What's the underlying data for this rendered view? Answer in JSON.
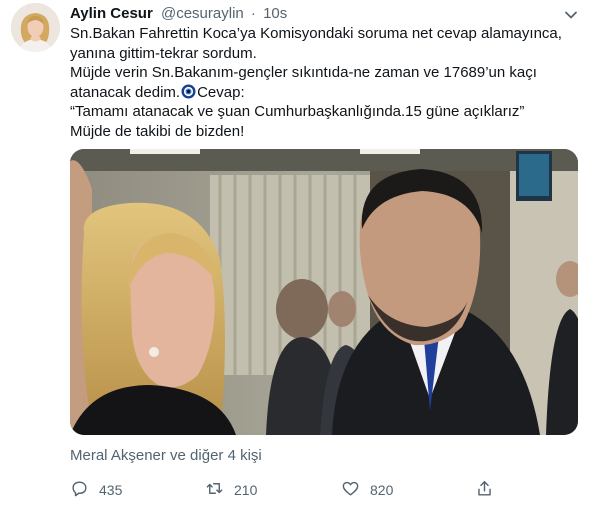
{
  "tweet": {
    "display_name": "Aylin Cesur",
    "handle": "@cesuraylin",
    "separator": "·",
    "time": "10s",
    "text_lines": [
      "Sn.Bakan Fahrettin Koca’ya Komisyondaki soruma net cevap alamayınca,",
      "yanına gittim-tekrar sordum.",
      "Müjde verin Sn.Bakanım-gençler sıkıntıda-ne zaman ve 17689’un kaçı",
      "“Tamamı atanacak ve şuan Cumhurbaşkanlığında.15 güne açıklarız”",
      "Müjde de takibi de bizden!"
    ],
    "line4_before": "atanacak dedim.",
    "line4_after": "Cevap:",
    "nazar_icon": "nazar-boncugu-icon",
    "likers": "Meral Akşener ve diğer 4 kişi",
    "actions": {
      "reply_count": "435",
      "retweet_count": "210",
      "like_count": "820"
    }
  },
  "colors": {
    "text": "#0f1419",
    "secondary": "#536471",
    "nazar_blue": "#1d3f91"
  },
  "icons": [
    "more-icon",
    "reply-icon",
    "retweet-icon",
    "like-icon",
    "share-icon"
  ]
}
